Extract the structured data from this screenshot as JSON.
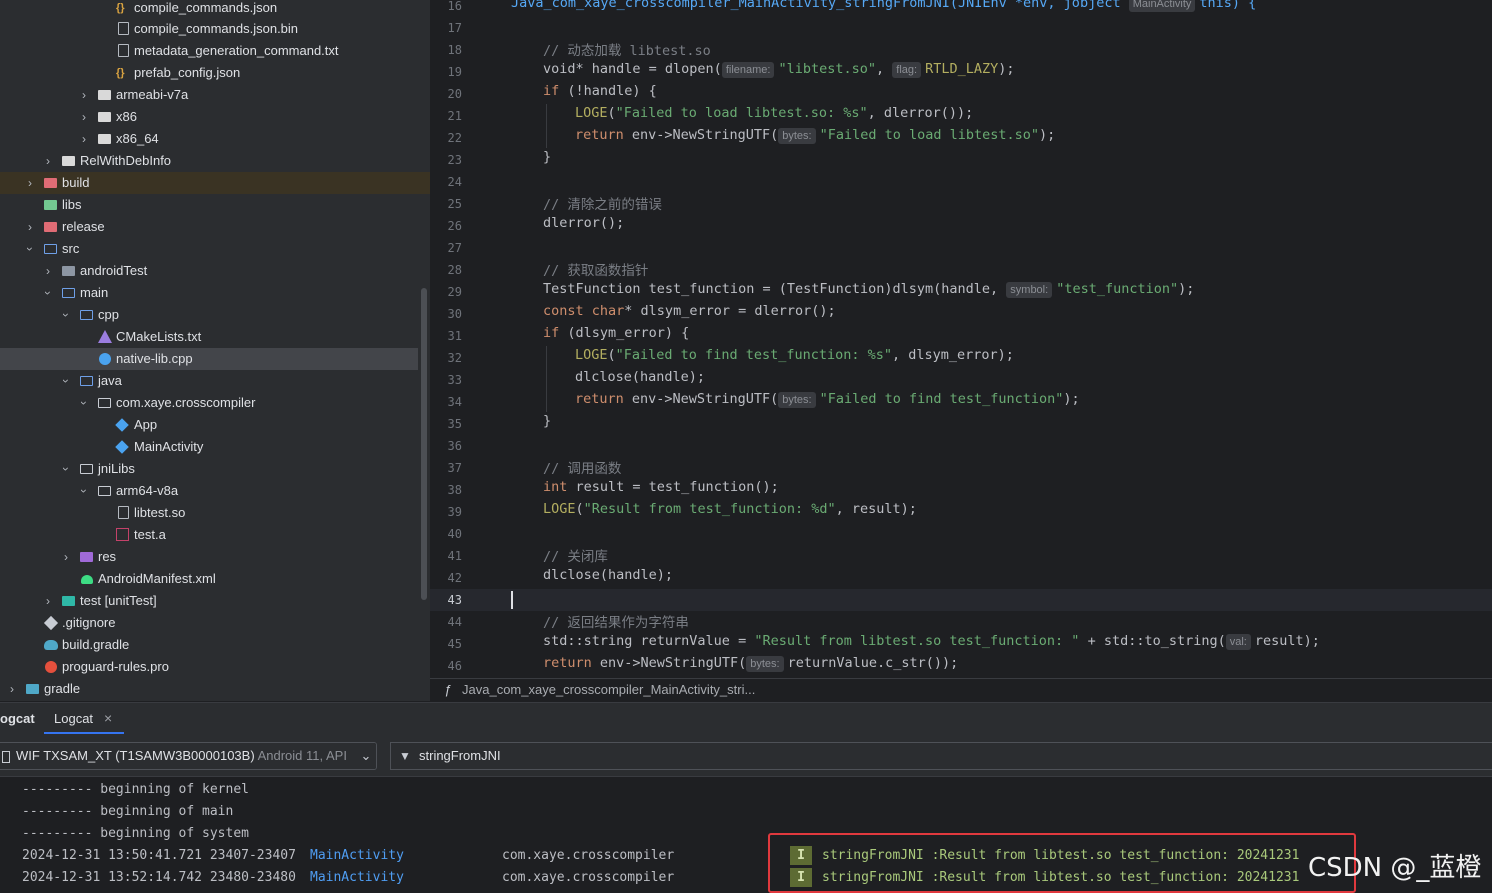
{
  "tree": {
    "items": [
      {
        "label": "compile_commands.json"
      },
      {
        "label": "compile_commands.json.bin"
      },
      {
        "label": "metadata_generation_command.txt"
      },
      {
        "label": "prefab_config.json"
      },
      {
        "label": "armeabi-v7a"
      },
      {
        "label": "x86"
      },
      {
        "label": "x86_64"
      },
      {
        "label": "RelWithDebInfo"
      },
      {
        "label": "build"
      },
      {
        "label": "libs"
      },
      {
        "label": "release"
      },
      {
        "label": "src"
      },
      {
        "label": "androidTest"
      },
      {
        "label": "main"
      },
      {
        "label": "cpp"
      },
      {
        "label": "CMakeLists.txt"
      },
      {
        "label": "native-lib.cpp"
      },
      {
        "label": "java"
      },
      {
        "label": "com.xaye.crosscompiler"
      },
      {
        "label": "App"
      },
      {
        "label": "MainActivity"
      },
      {
        "label": "jniLibs"
      },
      {
        "label": "arm64-v8a"
      },
      {
        "label": "libtest.so"
      },
      {
        "label": "test.a"
      },
      {
        "label": "res"
      },
      {
        "label": "AndroidManifest.xml"
      },
      {
        "label": "test [unitTest]"
      },
      {
        "label": ".gitignore"
      },
      {
        "label": "build.gradle"
      },
      {
        "label": "proguard-rules.pro"
      },
      {
        "label": "gradle"
      }
    ]
  },
  "editor": {
    "line_numbers": [
      "16",
      "17",
      "18",
      "19",
      "20",
      "21",
      "22",
      "23",
      "24",
      "25",
      "26",
      "27",
      "28",
      "29",
      "30",
      "31",
      "32",
      "33",
      "34",
      "35",
      "36",
      "37",
      "38",
      "39",
      "40",
      "41",
      "42",
      "43",
      "44",
      "45",
      "46"
    ],
    "current_line": "43",
    "hints": {
      "mainactivity": "MainActivity",
      "filename": "filename:",
      "flag": "flag:",
      "bytes": "bytes:",
      "symbol": "symbol:",
      "val": "val:"
    },
    "code": {
      "l16a": "Java_com_xaye_crosscompiler_MainActivity_stringFromJNI(JNIEnv *env, jobject ",
      "l16b": "this) {",
      "l18": "// 动态加载 libtest.so",
      "l19a": "void* handle = dlopen(",
      "l19b": "\"libtest.so\"",
      "l19c": ", ",
      "l19d": "RTLD_LAZY",
      "l19e": ");",
      "l20a": "if",
      "l20b": " (!handle) {",
      "l21a": "LOGE",
      "l21b": "(",
      "l21c": "\"Failed to load libtest.so: %s\"",
      "l21d": ", dlerror());",
      "l22a": "return",
      "l22b": " env->NewStringUTF(",
      "l22c": "\"Failed to load libtest.so\"",
      "l22d": ");",
      "l23": "}",
      "l25": "// 清除之前的错误",
      "l26": "dlerror();",
      "l28": "// 获取函数指针",
      "l29a": "TestFunction test_function = (TestFunction)dlsym(handle, ",
      "l29b": "\"test_function\"",
      "l29c": ");",
      "l30a": "const",
      "l30b": " ",
      "l30c": "char",
      "l30d": "* dlsym_error = dlerror();",
      "l31a": "if",
      "l31b": " (dlsym_error) {",
      "l32a": "LOGE",
      "l32b": "(",
      "l32c": "\"Failed to find test_function: %s\"",
      "l32d": ", dlsym_error);",
      "l33": "dlclose(handle);",
      "l34a": "return",
      "l34b": " env->NewStringUTF(",
      "l34c": "\"Failed to find test_function\"",
      "l34d": ");",
      "l35": "}",
      "l37": "// 调用函数",
      "l38a": "int",
      "l38b": " result = test_function();",
      "l39a": "LOGE",
      "l39b": "(",
      "l39c": "\"Result from test_function: %d\"",
      "l39d": ", result);",
      "l41": "// 关闭库",
      "l42": "dlclose(handle);",
      "l44": "// 返回结果作为字符串",
      "l45a": "std::string returnValue = ",
      "l45b": "\"Result from libtest.so test_function: \"",
      "l45c": " + std::to_string(",
      "l45d": "result);",
      "l46a": "return",
      "l46b": " env->NewStringUTF(",
      "l46c": "returnValue.c_str());"
    }
  },
  "breadcrumb": {
    "icon": "function-icon",
    "text": "Java_com_xaye_crosscompiler_MainActivity_stri..."
  },
  "logcat": {
    "tab_title": "ogcat",
    "tab_label": "Logcat",
    "tab_close": "×",
    "device": "WIF TXSAM_XT (T1SAMW3B0000103B)",
    "device_sub": "Android 11, API",
    "filter": "stringFromJNI",
    "lines": [
      {
        "text": "--------- beginning of kernel"
      },
      {
        "text": "--------- beginning of main"
      },
      {
        "text": "--------- beginning of system"
      },
      {
        "time": "2024-12-31 13:50:41.721 23407-23407",
        "tag": "MainActivity",
        "pkg": "com.xaye.crosscompiler",
        "level": "I",
        "message": "stringFromJNI :Result from libtest.so test_function: 20241231"
      },
      {
        "time": "2024-12-31 13:52:14.742 23480-23480",
        "tag": "MainActivity",
        "pkg": "com.xaye.crosscompiler",
        "level": "I",
        "message": "stringFromJNI :Result from libtest.so test_function: 20241231"
      }
    ]
  },
  "watermark": "CSDN @_蓝橙",
  "colors": {
    "accent": "#3574f0",
    "highlight_box": "#e0393e",
    "string": "#6aab73",
    "keyword": "#cf8e6d",
    "comment": "#7a7e85"
  }
}
